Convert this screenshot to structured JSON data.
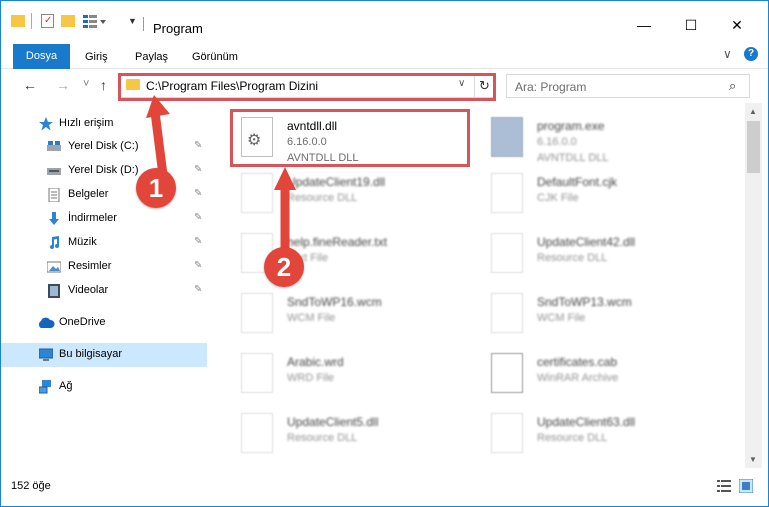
{
  "window": {
    "title": "Program",
    "minimize": "—",
    "maximize": "☐",
    "close": "✕"
  },
  "ribbon": {
    "tabs": [
      "Dosya",
      "Giriş",
      "Paylaş",
      "Görünüm"
    ],
    "expand": "∨",
    "help": "?"
  },
  "nav": {
    "back": "←",
    "forward": "→",
    "recent": "˅",
    "up": "↑",
    "address": "C:\\Program Files\\Program Dizini",
    "dropdown": "∨",
    "refresh": "↻",
    "search_placeholder": "Ara: Program",
    "search_icon": "⌕"
  },
  "sidebar": {
    "items": [
      {
        "label": "Hızlı erişim",
        "icon": "star-icon",
        "pinned": false
      },
      {
        "label": "Yerel Disk (C:)",
        "icon": "drive-icon",
        "pinned": true
      },
      {
        "label": "Yerel Disk (D:)",
        "icon": "drive-icon",
        "pinned": true
      },
      {
        "label": "Belgeler",
        "icon": "documents-icon",
        "pinned": true
      },
      {
        "label": "İndirmeler",
        "icon": "download-icon",
        "pinned": true
      },
      {
        "label": "Müzik",
        "icon": "music-icon",
        "pinned": true
      },
      {
        "label": "Resimler",
        "icon": "pictures-icon",
        "pinned": true
      },
      {
        "label": "Videolar",
        "icon": "videos-icon",
        "pinned": true
      },
      {
        "label": "OneDrive",
        "icon": "cloud-icon",
        "pinned": false
      },
      {
        "label": "Bu bilgisayar",
        "icon": "computer-icon",
        "pinned": false
      },
      {
        "label": "Ağ",
        "icon": "network-icon",
        "pinned": false
      }
    ],
    "pin_glyph": "📌"
  },
  "files": [
    {
      "name": "avntdll.dll",
      "line1": "6.16.0.0",
      "line2": "AVNTDLL DLL"
    },
    {
      "name": "program.exe",
      "line1": "6.16.0.0",
      "line2": "AVNTDLL DLL"
    },
    {
      "name": "UpdateClient19.dll",
      "line1": "Resource DLL",
      "line2": ""
    },
    {
      "name": "DefaultFont.cjk",
      "line1": "CJK File",
      "line2": ""
    },
    {
      "name": "help.fineReader.txt",
      "line1": "Text File",
      "line2": ""
    },
    {
      "name": "UpdateClient42.dll",
      "line1": "Resource DLL",
      "line2": ""
    },
    {
      "name": "SndToWP16.wcm",
      "line1": "WCM File",
      "line2": ""
    },
    {
      "name": "SndToWP13.wcm",
      "line1": "WCM File",
      "line2": ""
    },
    {
      "name": "Arabic.wrd",
      "line1": "WRD File",
      "line2": ""
    },
    {
      "name": "certificates.cab",
      "line1": "WinRAR Archive",
      "line2": ""
    },
    {
      "name": "UpdateClient5.dll",
      "line1": "Resource DLL",
      "line2": ""
    },
    {
      "name": "UpdateClient63.dll",
      "line1": "Resource DLL",
      "line2": ""
    }
  ],
  "status": {
    "count": "152 öğe"
  },
  "callouts": [
    "1",
    "2"
  ]
}
